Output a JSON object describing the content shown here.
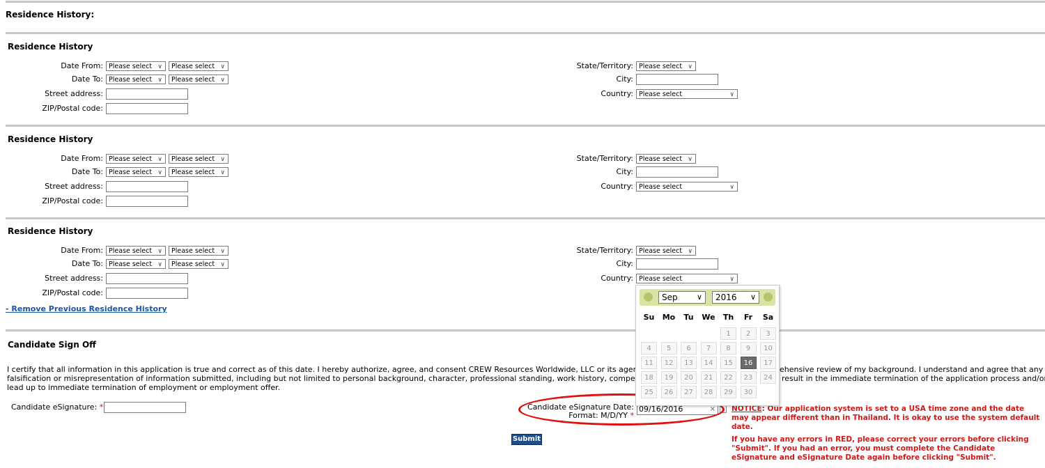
{
  "page_title": "Residence History:",
  "residence_blocks": [
    {
      "title": "Residence History",
      "date_from_label": "Date From:",
      "date_to_label": "Date To:",
      "street_label": "Street address:",
      "zip_label": "ZIP/Postal code:",
      "state_label": "State/Territory:",
      "city_label": "City:",
      "country_label": "Country:",
      "select_placeholder": "Please select"
    },
    {
      "title": "Residence History",
      "date_from_label": "Date From:",
      "date_to_label": "Date To:",
      "street_label": "Street address:",
      "zip_label": "ZIP/Postal code:",
      "state_label": "State/Territory:",
      "city_label": "City:",
      "country_label": "Country:",
      "select_placeholder": "Please select"
    },
    {
      "title": "Residence History",
      "date_from_label": "Date From:",
      "date_to_label": "Date To:",
      "street_label": "Street address:",
      "zip_label": "ZIP/Postal code:",
      "state_label": "State/Territory:",
      "city_label": "City:",
      "country_label": "Country:",
      "select_placeholder": "Please select"
    }
  ],
  "remove_link": "- Remove Previous Residence History",
  "sign_off": {
    "title": "Candidate Sign Off",
    "line1_left": "I certify that all information in this application is true and correct as of this date.  I hereby authorize, agree, and consent CREW Resources Worldwide, LLC or its agents a",
    "line1_right": "ehensive review of my background.  I understand and agree that any",
    "line2_left": "falsification or misrepresentation of information submitted, including but not limited to personal background, character, professional standing, work history, compensation",
    "line2_right": "result in the immediate termination of the application process and/or",
    "line3": "lead up to immediate termination of employment or employment offer.",
    "esignature_label": "Candidate eSignature:",
    "required_mark": "*",
    "esig_date_label": "Candidate eSignature Date:",
    "format_label": "Format: M/D/YY",
    "esig_date_value": "09/16/2016",
    "clear_glyph": "×",
    "submit_label": "Submit"
  },
  "notice": {
    "heading": "NOTICE",
    "text1": ":  Our application system is set to a USA time zone and the date may appear different than in Thailand.  It is okay to use the system default date.",
    "text2": "If you have any errors in RED, please correct your errors before clicking \"Submit\".  If you had an error, you must complete the Candidate eSignature and eSignature Date again before clicking \"Submit\"."
  },
  "calendar": {
    "month": "Sep",
    "year": "2016",
    "weekdays": [
      "Su",
      "Mo",
      "Tu",
      "We",
      "Th",
      "Fr",
      "Sa"
    ],
    "weeks": [
      [
        "",
        "",
        "",
        "",
        "1",
        "2",
        "3"
      ],
      [
        "4",
        "5",
        "6",
        "7",
        "8",
        "9",
        "10"
      ],
      [
        "11",
        "12",
        "13",
        "14",
        "15",
        "16",
        "17"
      ],
      [
        "18",
        "19",
        "20",
        "21",
        "22",
        "23",
        "24"
      ],
      [
        "25",
        "26",
        "27",
        "28",
        "29",
        "30",
        ""
      ]
    ],
    "selected_day": "16"
  },
  "colors": {
    "notice_red": "#d01818",
    "link_blue": "#1a55a8",
    "submit_blue": "#1b4f8f",
    "calendar_header": "#d7e4a6",
    "highlight_oval": "#e01010"
  }
}
